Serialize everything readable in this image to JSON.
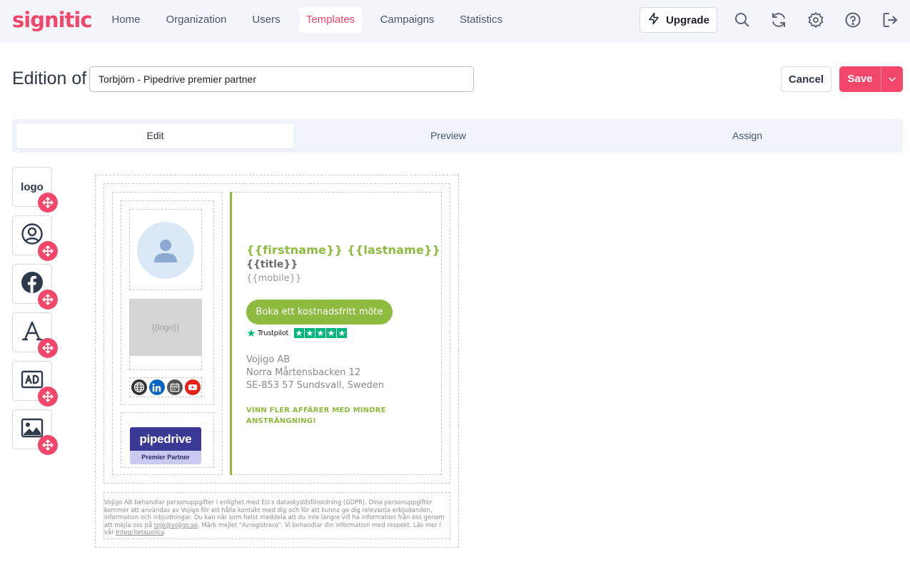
{
  "app": {
    "brand": "signitic"
  },
  "nav": {
    "items": [
      {
        "label": "Home",
        "active": false
      },
      {
        "label": "Organization",
        "active": false
      },
      {
        "label": "Users",
        "active": false
      },
      {
        "label": "Templates",
        "active": true
      },
      {
        "label": "Campaigns",
        "active": false
      },
      {
        "label": "Statistics",
        "active": false
      }
    ],
    "upgrade_label": "Upgrade",
    "icons": [
      "search-icon",
      "refresh-icon",
      "gear-icon",
      "help-icon",
      "logout-icon"
    ]
  },
  "editor": {
    "edition_label": "Edition of",
    "template_name": "Torbjörn - Pipedrive premier partner",
    "cancel_label": "Cancel",
    "save_label": "Save"
  },
  "tabs": [
    {
      "label": "Edit",
      "active": true
    },
    {
      "label": "Preview",
      "active": false
    },
    {
      "label": "Assign",
      "active": false
    }
  ],
  "palette": {
    "items": [
      {
        "name": "logo-block",
        "label": "logo",
        "icon": "logo-text"
      },
      {
        "name": "avatar-block",
        "icon": "user-circle-icon"
      },
      {
        "name": "social-block",
        "icon": "facebook-icon"
      },
      {
        "name": "text-block",
        "icon": "font-icon"
      },
      {
        "name": "banner-block",
        "icon": "ad-icon"
      },
      {
        "name": "image-block",
        "icon": "image-icon"
      }
    ]
  },
  "signature": {
    "logo_placeholder": "{{logo}}",
    "name": "{{firstname}} {{lastname}}",
    "title": "{{title}}",
    "mobile": "{{mobile}}",
    "cta": "Boka ett kostnadsfritt möte",
    "trustpilot": "Trustpilot",
    "trustpilot_stars": 5,
    "company": "Vojigo AB",
    "street": "Norra Mårtensbacken 12",
    "city": "SE-853 57 Sundsvall, Sweden",
    "slogan_line1": "VINN FLER AFFÄRER MED MINDRE",
    "slogan_line2": "ANSTRÄNGNING!",
    "social": [
      "globe-icon",
      "linkedin-icon",
      "calendar-icon",
      "youtube-icon"
    ],
    "partner_logo_top": "pipedrive",
    "partner_logo_bottom": "Premier Partner",
    "colors": {
      "accent": "#8dbb3f",
      "brand": "#f2476a",
      "partner": "#3a3a96",
      "trustpilot": "#00b67a"
    }
  },
  "disclaimer": {
    "text": "Vojigo AB behandlar personuppgifter i enlighet med EU:s dataskyddsförordning (GDPR). Dina personuppgifter kommer att användas av Vojigo för att hålla kontakt med dig och för att kunna ge dig relevanta erbjudanden, information och inbjudningar. Du kan när som helst meddela att du inte längre vill ha information från oss genom att mejla oss på ",
    "email": "tojo@vojigo.se",
    "text2": ". Märk mejlet \"Avregistrera\". Vi behandlar din information med respekt. Läs mer i vår ",
    "policy": "Integritetspolicy",
    "end": "."
  }
}
